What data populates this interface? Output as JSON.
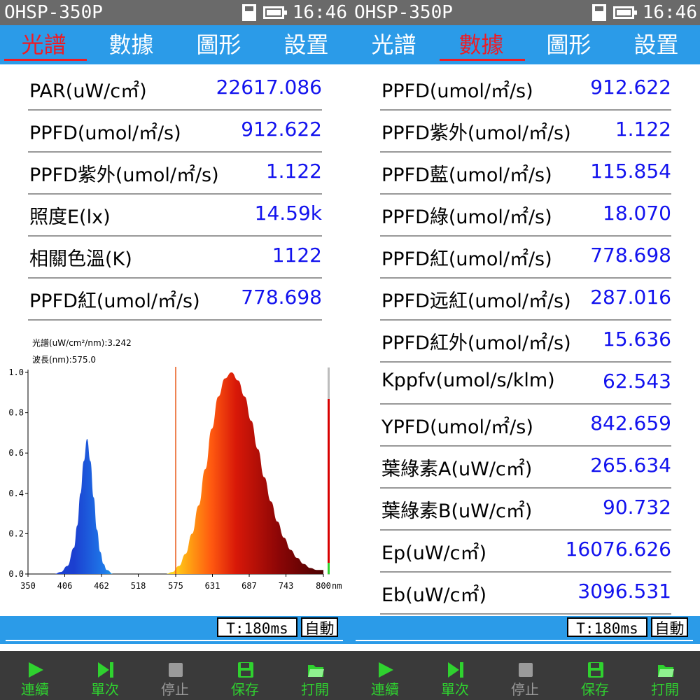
{
  "left": {
    "app_title": "OHSP-350P",
    "clock": "16:46",
    "tabs": [
      {
        "label": "光譜"
      },
      {
        "label": "數據"
      },
      {
        "label": "圖形"
      },
      {
        "label": "設置"
      }
    ],
    "active_tab": 0,
    "rows": [
      {
        "label": "PAR(uW/c㎡)",
        "value": "22617.086"
      },
      {
        "label": "PPFD(umol/㎡/s)",
        "value": "912.622"
      },
      {
        "label": "PPFD紫外(umol/㎡/s)",
        "value": "1.122"
      },
      {
        "label": "照度E(lx)",
        "value": "14.59k"
      },
      {
        "label": "相關色溫(K)",
        "value": "1122"
      },
      {
        "label": "PPFD紅(umol/㎡/s)",
        "value": "778.698"
      }
    ],
    "chart_data": {
      "type": "area",
      "cursor_readout_1": "光譜(uW/cm²/nm):3.242",
      "cursor_readout_2": "波長(nm):575.0",
      "x_unit": "nm",
      "x_ticks": [
        "350",
        "406",
        "462",
        "518",
        "575",
        "631",
        "687",
        "743",
        "800"
      ],
      "y_ticks": [
        "0.0",
        "0.2",
        "0.4",
        "0.6",
        "0.8",
        "1.0"
      ],
      "xlim": [
        350,
        800
      ],
      "ylim": [
        0,
        1.0
      ],
      "cursor_wavelength": 575.0,
      "x": [
        390,
        400,
        410,
        420,
        425,
        430,
        435,
        440,
        445,
        450,
        455,
        460,
        465,
        470,
        480,
        500,
        520,
        540,
        560,
        570,
        580,
        590,
        600,
        610,
        620,
        630,
        640,
        650,
        660,
        670,
        680,
        690,
        700,
        710,
        720,
        730,
        740,
        750,
        760,
        770,
        780,
        790,
        800
      ],
      "y": [
        0.0,
        0.01,
        0.04,
        0.13,
        0.24,
        0.4,
        0.56,
        0.67,
        0.56,
        0.38,
        0.22,
        0.11,
        0.05,
        0.02,
        0.0,
        0.0,
        0.0,
        0.0,
        0.0,
        0.01,
        0.04,
        0.1,
        0.2,
        0.34,
        0.52,
        0.72,
        0.88,
        0.97,
        1.0,
        0.96,
        0.88,
        0.76,
        0.62,
        0.48,
        0.36,
        0.26,
        0.18,
        0.12,
        0.08,
        0.05,
        0.03,
        0.02,
        0.02
      ],
      "grid": false,
      "colors": {
        "blue": "#1a4fd6",
        "red": "#c81e00",
        "cursor": "#e85a1a"
      }
    }
  },
  "right": {
    "app_title": "OHSP-350P",
    "clock": "16:46",
    "tabs": [
      {
        "label": "光譜"
      },
      {
        "label": "數據"
      },
      {
        "label": "圖形"
      },
      {
        "label": "設置"
      }
    ],
    "active_tab": 1,
    "rows": [
      {
        "label": "PPFD(umol/㎡/s)",
        "value": "912.622"
      },
      {
        "label": "PPFD紫外(umol/㎡/s)",
        "value": "1.122"
      },
      {
        "label": "PPFD藍(umol/㎡/s)",
        "value": "115.854"
      },
      {
        "label": "PPFD綠(umol/㎡/s)",
        "value": "18.070"
      },
      {
        "label": "PPFD紅(umol/㎡/s)",
        "value": "778.698"
      },
      {
        "label": "PPFD远紅(umol/㎡/s)",
        "value": "287.016"
      },
      {
        "label": "PPFD紅外(umol/㎡/s)",
        "value": "15.636"
      },
      {
        "label": "Kppfv(umol/s/klm)",
        "value": "62.543"
      },
      {
        "label": "YPFD(umol/㎡/s)",
        "value": "842.659"
      },
      {
        "label": "葉綠素A(uW/c㎡)",
        "value": "265.634"
      },
      {
        "label": "葉綠素B(uW/c㎡)",
        "value": "90.732"
      },
      {
        "label": "Ep(uW/c㎡)",
        "value": "16076.626"
      },
      {
        "label": "Eb(uW/c㎡)",
        "value": "3096.531"
      }
    ]
  },
  "status": {
    "integration_time": "T:180ms",
    "mode": "自動"
  },
  "toolbar": {
    "continuous": "連續",
    "single": "單次",
    "stop": "停止",
    "save": "保存",
    "open": "打開"
  },
  "colors": {
    "tab_bar": "#2b9be8",
    "active_tab": "#ee1c25",
    "value_text": "#1212ee",
    "toolbar_bg": "#3a3a3a",
    "toolbar_active": "#2fd22f",
    "toolbar_disabled": "#9a9a9a"
  }
}
